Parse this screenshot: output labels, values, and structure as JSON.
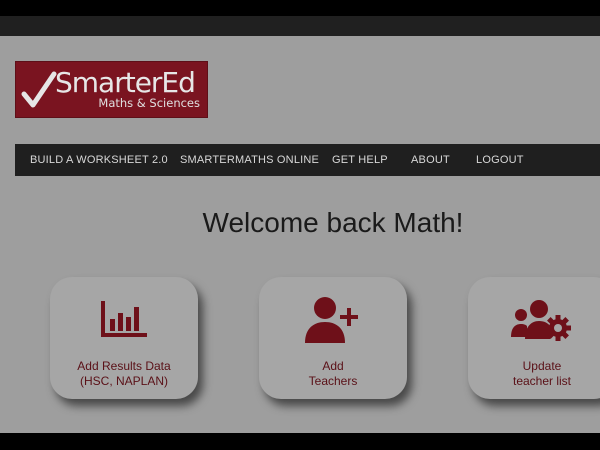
{
  "brand": {
    "title": "SmarterEd",
    "subtitle": "Maths & Sciences",
    "color": "#7a1420"
  },
  "nav": {
    "items": [
      {
        "label": "BUILD A WORKSHEET 2.0"
      },
      {
        "label": "SMARTERMATHS ONLINE"
      },
      {
        "label": "GET HELP"
      },
      {
        "label": "ABOUT"
      },
      {
        "label": "LOGOUT"
      }
    ]
  },
  "welcome": "Welcome back Math!",
  "cards": [
    {
      "icon": "bar-chart-icon",
      "line1": "Add Results Data",
      "line2": "(HSC, NAPLAN)"
    },
    {
      "icon": "add-user-icon",
      "line1": "Add",
      "line2": "Teachers"
    },
    {
      "icon": "users-gear-icon",
      "line1": "Update",
      "line2": "teacher list"
    }
  ],
  "colors": {
    "accent": "#7a1420",
    "nav_bg": "#1f1f1f",
    "page_bg": "#9e9e9e"
  }
}
